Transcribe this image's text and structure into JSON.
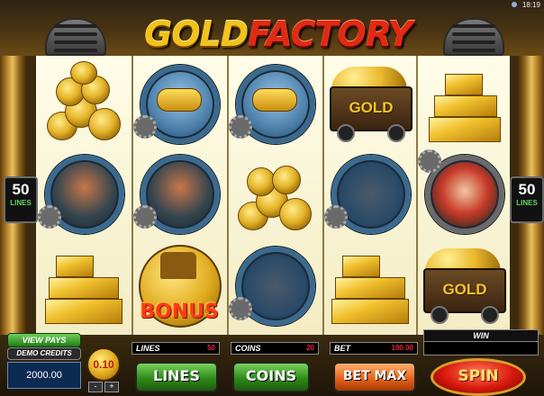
{
  "status": {
    "time": "18:19"
  },
  "title": {
    "part1": "GOLD",
    "part2": "FACTORY"
  },
  "reels": [
    [
      "gold-coins-stack",
      "steam-train-badge",
      "gold-bars"
    ],
    [
      "submarine-badge",
      "steam-train-badge",
      "bonus-coin"
    ],
    [
      "submarine-badge",
      "gold-coins-stack",
      "factory-badge"
    ],
    [
      "gold-cart",
      "factory-badge",
      "gold-bars"
    ],
    [
      "gold-bars",
      "factory-owner-badge",
      "gold-cart"
    ]
  ],
  "symbol_text": {
    "gold_cart": "GOLD",
    "bonus": "BONUS"
  },
  "side_lines": {
    "value": "50",
    "label": "LINES"
  },
  "controls": {
    "view_pays": "VIEW PAYS",
    "demo_credits_label": "DEMO CREDITS",
    "credits_value": "2000.00",
    "coin_value": "0.10",
    "lines_label": "LINES",
    "lines_value": "50",
    "coins_label": "COINS",
    "coins_value": "20",
    "bet_label": "BET",
    "bet_value": "100.00",
    "win_label": "WIN",
    "lines_button": "LINES",
    "coins_button": "COINS",
    "betmax_button": "BET MAX",
    "spin_button": "SPIN",
    "minus": "-",
    "plus": "+"
  },
  "colors": {
    "gold": "#f2c21c",
    "red": "#e02b14",
    "green_btn": "#3a9a2a",
    "orange_btn": "#e8641a"
  }
}
